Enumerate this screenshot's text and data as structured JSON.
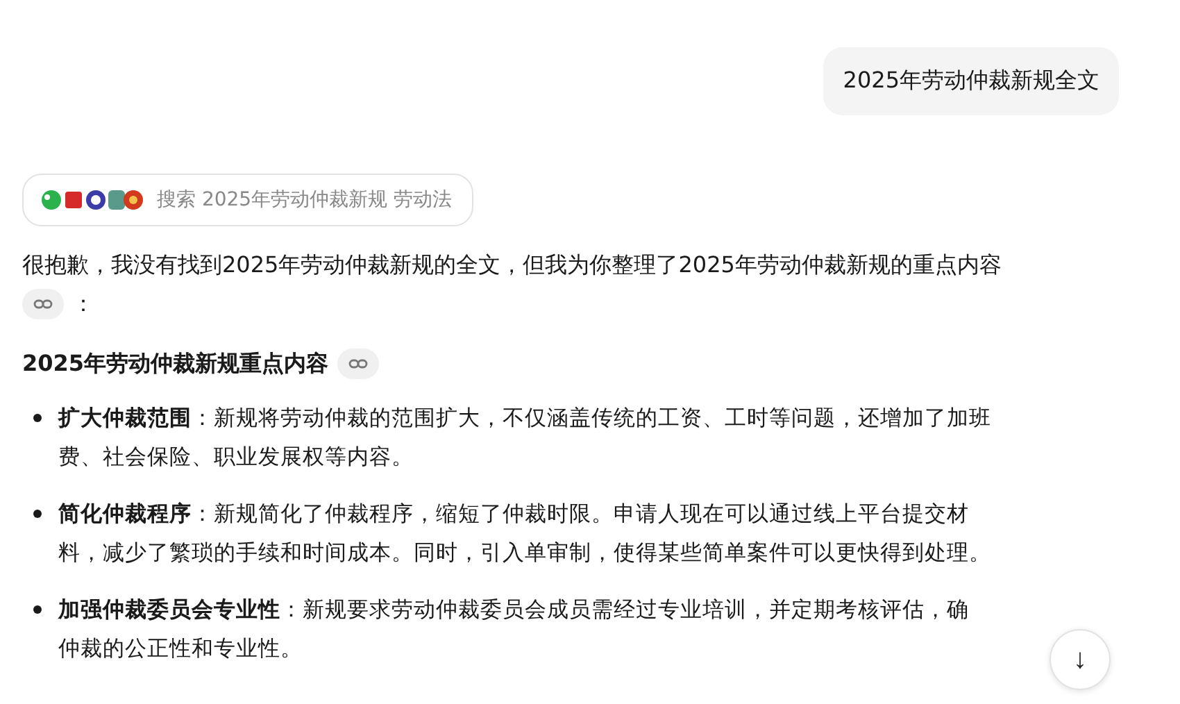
{
  "user_message": "2025年劳动仲裁新规全文",
  "search_chip": {
    "label": "搜索 2025年劳动仲裁新规 劳动法"
  },
  "intro": {
    "text": "很抱歉，我没有找到2025年劳动仲裁新规的全文，但我为你整理了2025年劳动仲裁新规的重点内容",
    "after_link": "："
  },
  "heading": "2025年劳动仲裁新规重点内容",
  "items": [
    {
      "term": "扩大仲裁范围",
      "sep": "：",
      "lines": [
        "新规将劳动仲裁的范围扩大，不仅涵盖传统的工资、工时等问题，还增加了加班",
        "费、社会保险、职业发展权等内容。"
      ]
    },
    {
      "term": "简化仲裁程序",
      "sep": "：",
      "lines": [
        "新规简化了仲裁程序，缩短了仲裁时限。申请人现在可以通过线上平台提交材",
        "料，减少了繁琐的手续和时间成本。同时，引入单审制，使得某些简单案件可以更快得到处理。"
      ]
    },
    {
      "term": "加强仲裁委员会专业性",
      "sep": "：",
      "lines": [
        "新规要求劳动仲裁委员会成员需经过专业培训，并定期考核评估，确",
        "仲裁的公正性和专业性。"
      ]
    }
  ],
  "scroll_button": "↓"
}
